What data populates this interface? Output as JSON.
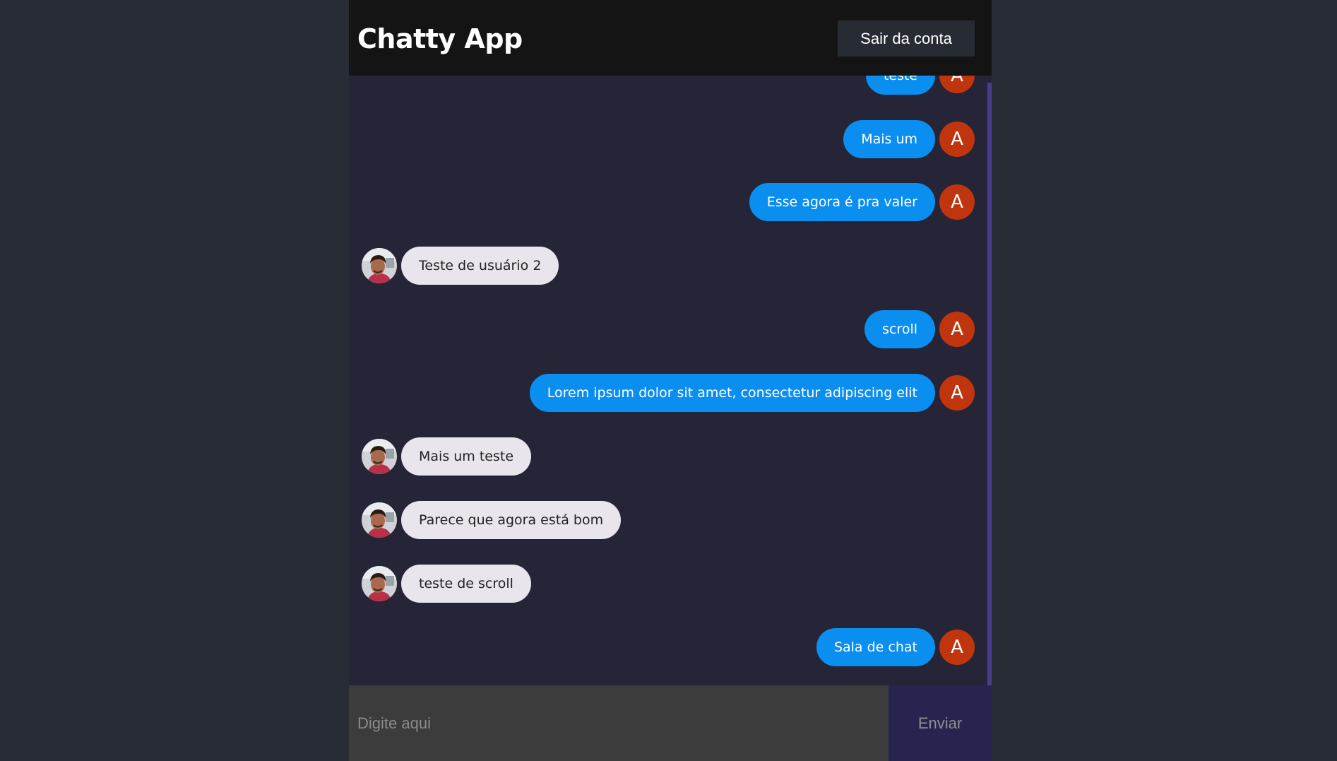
{
  "header": {
    "title": "Chatty App",
    "logout_label": "Sair da conta"
  },
  "messages": [
    {
      "sender": "me",
      "avatar": "A",
      "text": "teste"
    },
    {
      "sender": "me",
      "avatar": "A",
      "text": "Mais um"
    },
    {
      "sender": "me",
      "avatar": "A",
      "text": "Esse agora é pra valer"
    },
    {
      "sender": "other",
      "avatar": "user-photo",
      "text": "Teste de usuário 2"
    },
    {
      "sender": "me",
      "avatar": "A",
      "text": "scroll"
    },
    {
      "sender": "me",
      "avatar": "A",
      "text": "Lorem ipsum dolor sit amet, consectetur adipiscing elit"
    },
    {
      "sender": "other",
      "avatar": "user-photo",
      "text": "Mais um teste"
    },
    {
      "sender": "other",
      "avatar": "user-photo",
      "text": "Parece que agora está bom"
    },
    {
      "sender": "other",
      "avatar": "user-photo",
      "text": "teste de scroll"
    },
    {
      "sender": "me",
      "avatar": "A",
      "text": "Sala de chat"
    }
  ],
  "composer": {
    "placeholder": "Digite aqui",
    "send_label": "Enviar"
  },
  "colors": {
    "page_background": "#282c34",
    "chat_background": "#262537",
    "header_background": "#141414",
    "my_bubble": "#0a8ef0",
    "their_bubble": "#e8e6ec",
    "my_avatar": "#c1350e",
    "send_button": "#272450",
    "input_background": "#3c3c3c",
    "scrollbar": "#4a3c8e"
  }
}
